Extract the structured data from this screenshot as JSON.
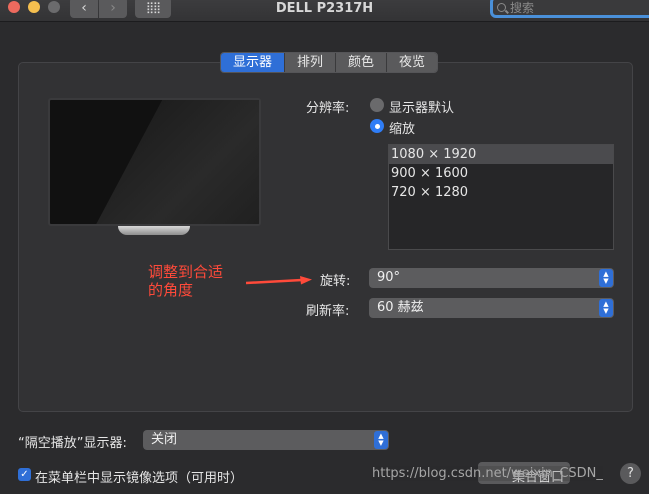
{
  "window": {
    "title": "DELL P2317H",
    "search_placeholder": "搜索"
  },
  "tabs": [
    {
      "label": "显示器",
      "active": true
    },
    {
      "label": "排列",
      "active": false
    },
    {
      "label": "颜色",
      "active": false
    },
    {
      "label": "夜览",
      "active": false
    }
  ],
  "resolution": {
    "label": "分辨率:",
    "option_default": "显示器默认",
    "option_scaled": "缩放",
    "selected_option": "缩放",
    "list": [
      "1080 × 1920",
      "900 × 1600",
      "720 × 1280"
    ],
    "selected_index": 0
  },
  "rotation": {
    "label": "旋转:",
    "value": "90°"
  },
  "refresh": {
    "label": "刷新率:",
    "value": "60 赫兹"
  },
  "annotation": {
    "line1": "调整到合适",
    "line2": "的角度",
    "color": "#ff4a3a"
  },
  "airplay": {
    "label": "“隔空播放”显示器:",
    "value": "关闭"
  },
  "mirror_option": {
    "label": "在菜单栏中显示镜像选项（可用时）",
    "checked": true
  },
  "footer": {
    "gather_label": "集合窗口",
    "watermark": "https://blog.csdn.net/weixin_CSDN_",
    "help": "?"
  },
  "colors": {
    "accent": "#2f6fd7",
    "background": "#2b2b2d"
  }
}
